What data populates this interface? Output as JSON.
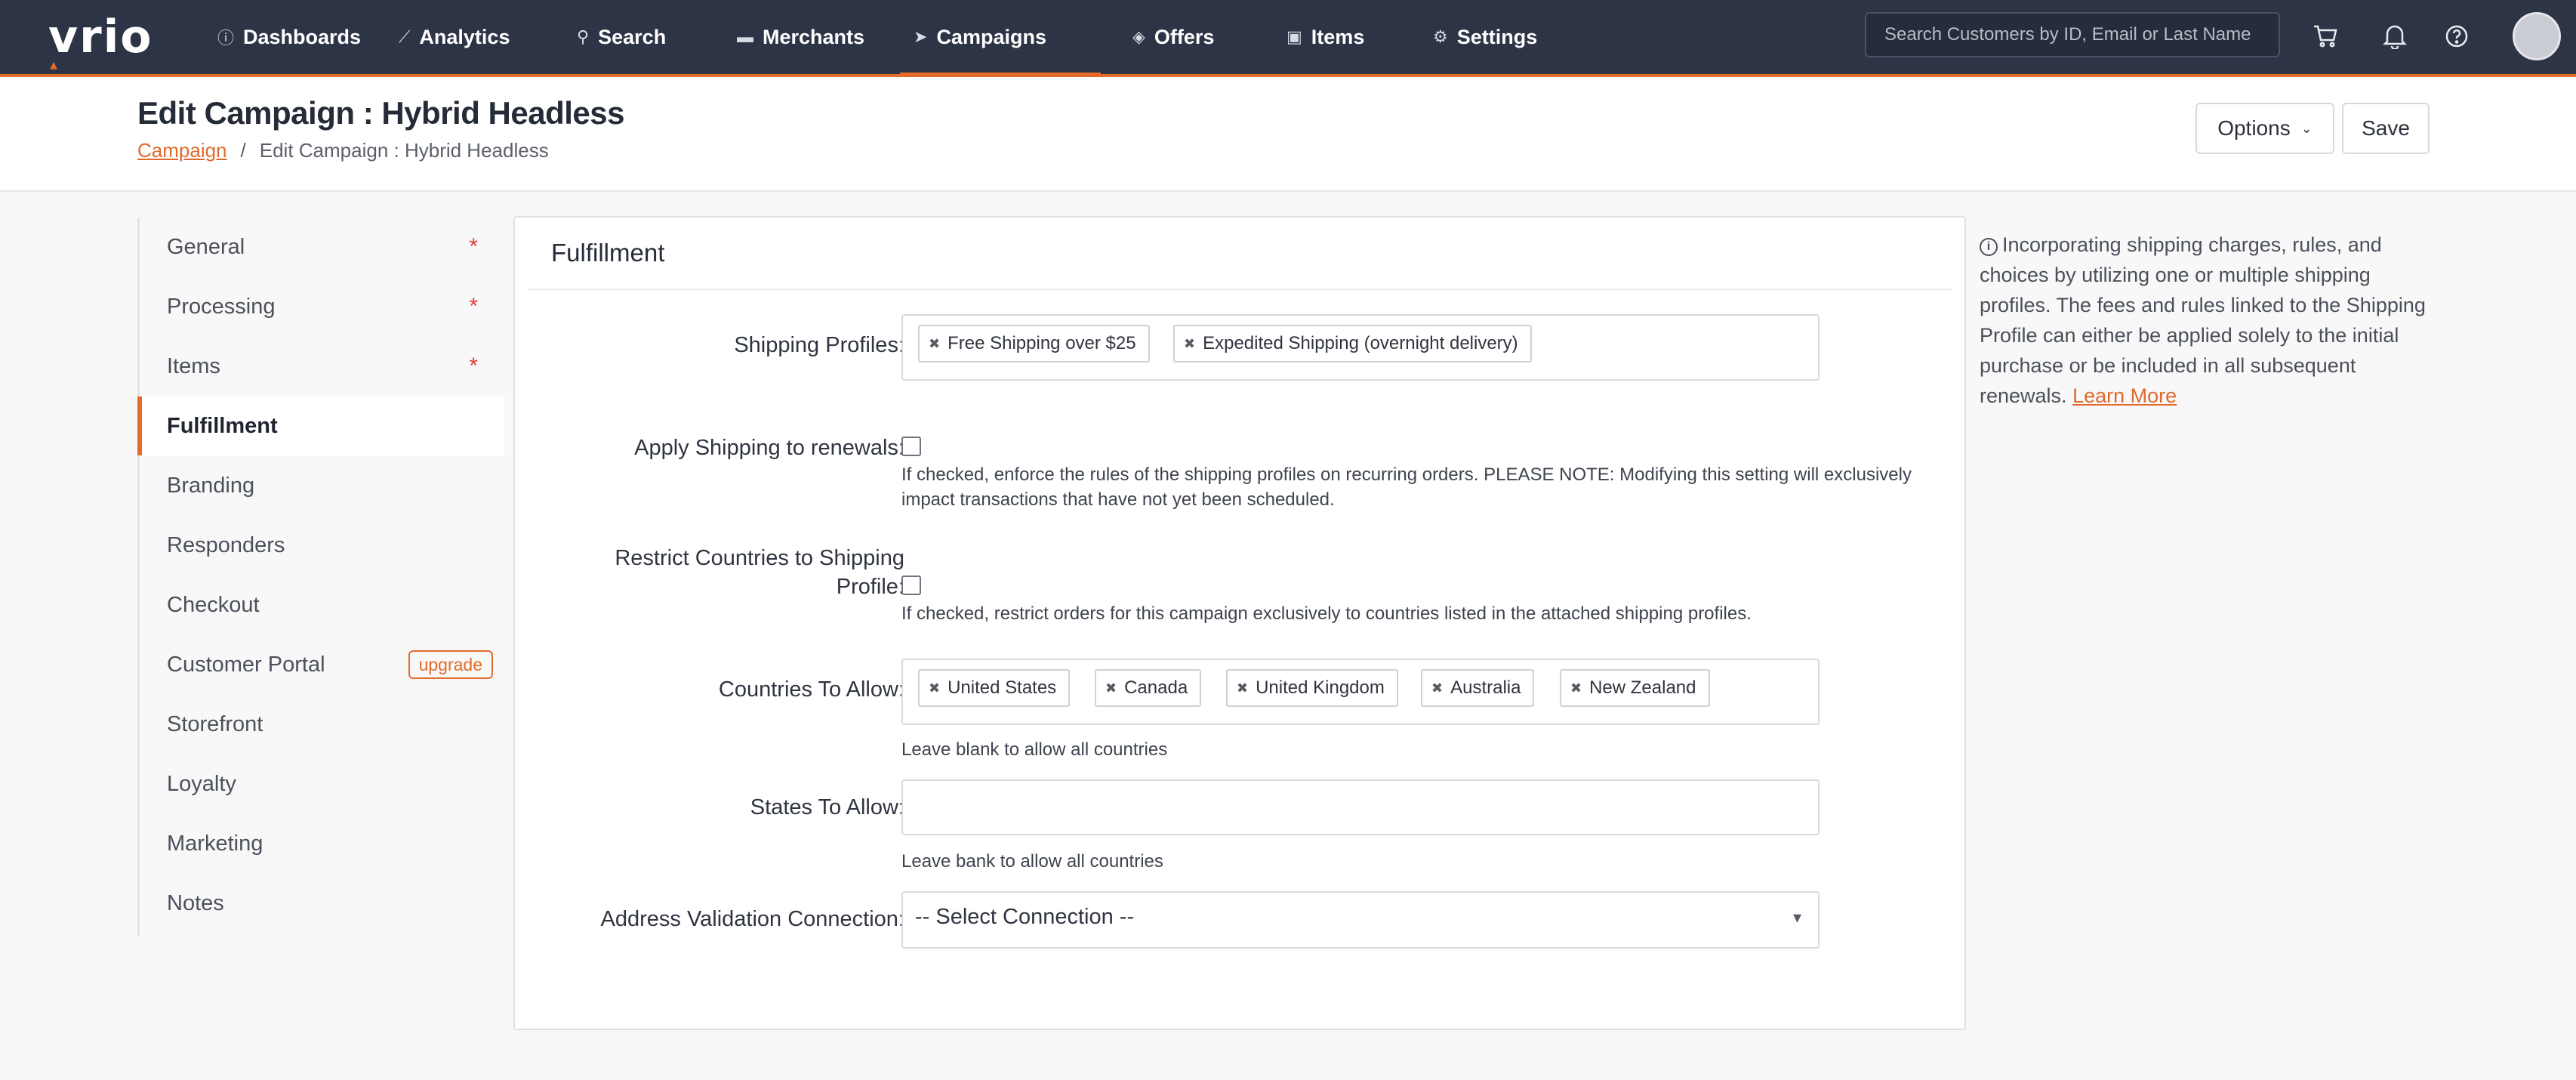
{
  "nav": {
    "logo": "vrio",
    "items": [
      {
        "label": "Dashboards",
        "icon": "ⓘ"
      },
      {
        "label": "Analytics",
        "icon": "⟋"
      },
      {
        "label": "Search",
        "icon": "⚲"
      },
      {
        "label": "Merchants",
        "icon": "▬"
      },
      {
        "label": "Campaigns",
        "icon": "➤"
      },
      {
        "label": "Offers",
        "icon": "◈"
      },
      {
        "label": "Items",
        "icon": "▣"
      },
      {
        "label": "Settings",
        "icon": "⚙"
      }
    ],
    "active_item": "Campaigns",
    "search_placeholder": "Search Customers by ID, Email or Last Name",
    "icons": [
      "cart-icon",
      "bell-icon",
      "help-icon",
      "avatar"
    ],
    "accent_color": "#e46b2a",
    "nav_bg": "#2c3446"
  },
  "header": {
    "title": "Edit Campaign : Hybrid Headless",
    "breadcrumb": {
      "parent": "Campaign",
      "separator": "/",
      "current": "Edit Campaign : Hybrid Headless"
    },
    "options_label": "Options",
    "save_label": "Save"
  },
  "sidebar": {
    "items": [
      {
        "label": "General",
        "required": "*"
      },
      {
        "label": "Processing",
        "required": "*"
      },
      {
        "label": "Items",
        "required": "*"
      },
      {
        "label": "Fulfillment",
        "active": true
      },
      {
        "label": "Branding"
      },
      {
        "label": "Responders"
      },
      {
        "label": "Checkout"
      },
      {
        "label": "Customer Portal",
        "badge": "upgrade"
      },
      {
        "label": "Storefront"
      },
      {
        "label": "Loyalty"
      },
      {
        "label": "Marketing"
      },
      {
        "label": "Notes"
      }
    ]
  },
  "card": {
    "title": "Fulfillment",
    "shipping_profiles": {
      "label": "Shipping Profiles:",
      "tags": [
        "Free Shipping over $25",
        "Expedited Shipping (overnight delivery)"
      ]
    },
    "apply_renewals": {
      "label": "Apply Shipping to renewals:",
      "checked": false,
      "help": "If checked, enforce the rules of the shipping profiles on recurring orders. PLEASE NOTE: Modifying this setting will exclusively impact transactions that have not yet been scheduled."
    },
    "restrict_countries": {
      "label_line1": "Restrict Countries to Shipping",
      "label_line2": "Profile:",
      "checked": false,
      "help": "If checked, restrict orders for this campaign exclusively to countries listed in the attached shipping profiles."
    },
    "countries": {
      "label": "Countries To Allow:",
      "tags": [
        "United States",
        "Canada",
        "United Kingdom",
        "Australia",
        "New Zealand"
      ],
      "help": "Leave blank to allow all countries"
    },
    "states": {
      "label": "States To Allow:",
      "value": "",
      "help": "Leave bank to allow all countries"
    },
    "address_validation": {
      "label": "Address Validation Connection:",
      "selected": "-- Select Connection --"
    }
  },
  "info": {
    "text": "Incorporating shipping charges, rules, and choices by utilizing one or multiple shipping profiles. The fees and rules linked to the Shipping Profile can either be applied solely to the initial purchase or be included in all subsequent renewals.",
    "link": "Learn More"
  }
}
